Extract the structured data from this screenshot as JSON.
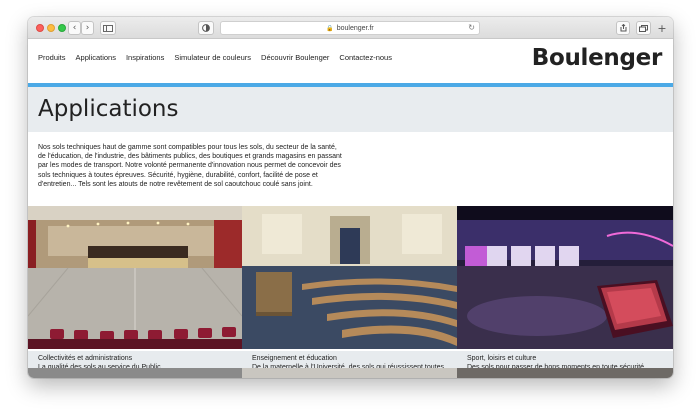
{
  "browser": {
    "url": "boulenger.fr",
    "back_icon": "‹",
    "forward_icon": "›"
  },
  "site": {
    "logo": "Boulenger",
    "nav": [
      "Produits",
      "Applications",
      "Inspirations",
      "Simulateur de couleurs",
      "Découvrir Boulenger",
      "Contactez-nous"
    ]
  },
  "hero": {
    "title": "Applications"
  },
  "intro": "Nos sols techniques haut de gamme sont compatibles pour tous les sols, du secteur de la santé, de l'éducation, de l'industrie, des bâtiments publics, des boutiques et grands magasins en passant par les modes de transport. Notre volonté permanente d'innovation nous permet de concevoir des sols techniques à toutes épreuves. Sécurité, hygiène, durabilité, confort, facilité de pose et d'entretien... Tels sont les atouts de notre revêtement de sol caoutchouc coulé sans joint.",
  "cards": [
    {
      "title": "Collectivités et administrations",
      "desc": "La qualité des sols au service du Public"
    },
    {
      "title": "Enseignement et éducation",
      "desc": "De la maternelle à l'Université, des sols qui réussissent toutes les épreuves"
    },
    {
      "title": "Sport, loisirs et culture",
      "desc": "Des sols pour passer de bons moments en toute sécurité"
    }
  ],
  "colors": {
    "accent": "#4ba9e6",
    "hero_bg": "#e8ecef"
  }
}
